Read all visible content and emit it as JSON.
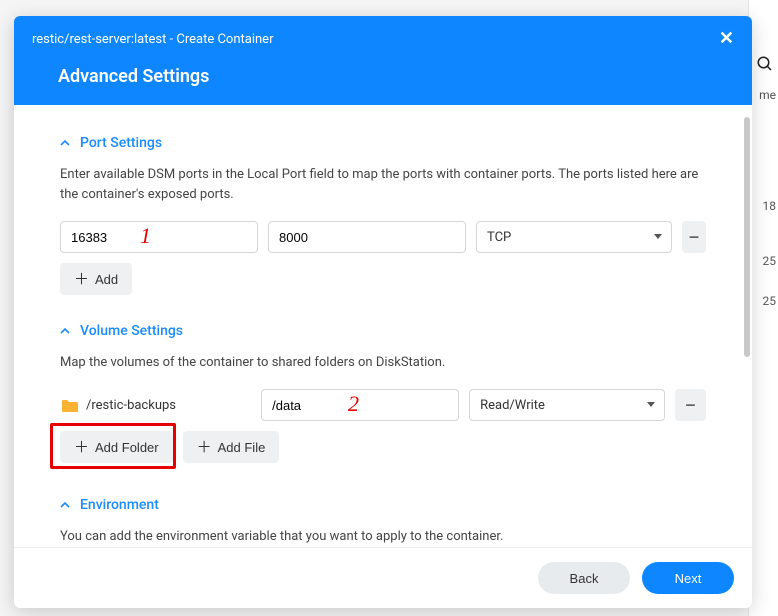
{
  "background": {
    "me_label": "me",
    "row1": "18",
    "row2": "25",
    "row3": "25"
  },
  "modal": {
    "title": "restic/rest-server:latest - Create Container",
    "subtitle": "Advanced Settings"
  },
  "port_section": {
    "header": "Port Settings",
    "desc": "Enter available DSM ports in the Local Port field to map the ports with container ports. The ports listed here are the container's exposed ports.",
    "rows": [
      {
        "local": "16383",
        "container": "8000",
        "type": "TCP"
      }
    ],
    "add_label": "Add"
  },
  "volume_section": {
    "header": "Volume Settings",
    "desc": "Map the volumes of the container to shared folders on DiskStation.",
    "rows": [
      {
        "host": "/restic-backups",
        "mount": "/data",
        "perm": "Read/Write"
      }
    ],
    "add_folder_label": "Add Folder",
    "add_file_label": "Add File"
  },
  "env_section": {
    "header": "Environment",
    "desc": "You can add the environment variable that you want to apply to the container."
  },
  "footer": {
    "back": "Back",
    "next": "Next"
  },
  "annotations": {
    "num1": "1",
    "num2": "2"
  }
}
